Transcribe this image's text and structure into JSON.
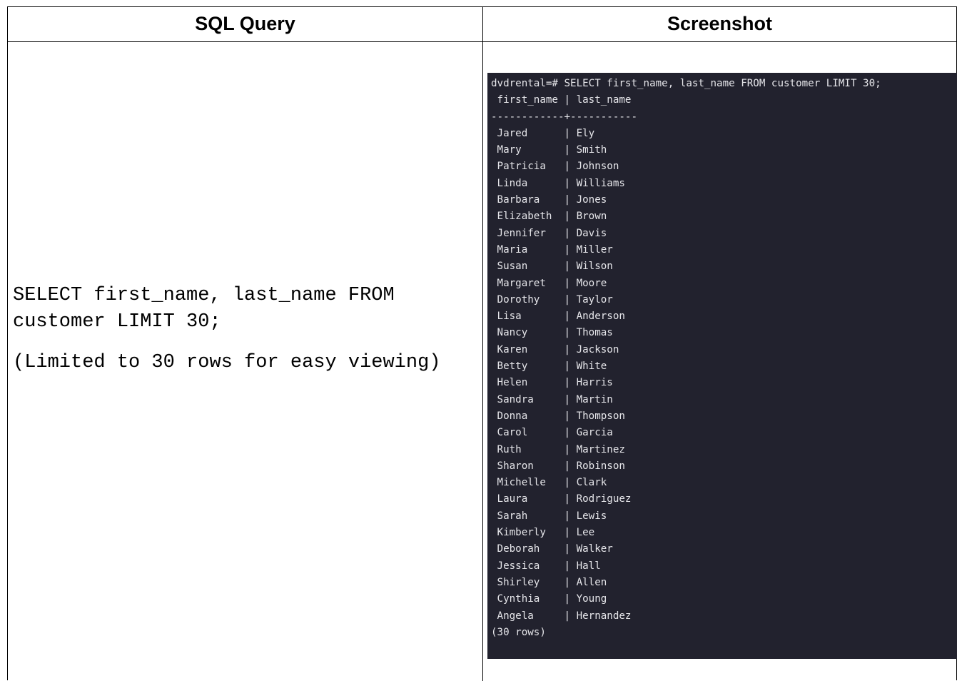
{
  "headers": {
    "left": "SQL Query",
    "right": "Screenshot"
  },
  "query": {
    "text": "SELECT first_name, last_name FROM customer LIMIT 30;",
    "note": "(Limited to 30 rows for easy viewing)"
  },
  "terminal": {
    "prompt_line": "dvdrental=# SELECT first_name, last_name FROM customer LIMIT 30;",
    "header_line": " first_name | last_name",
    "separator_line": "------------+-----------",
    "rows": [
      " Jared      | Ely",
      " Mary       | Smith",
      " Patricia   | Johnson",
      " Linda      | Williams",
      " Barbara    | Jones",
      " Elizabeth  | Brown",
      " Jennifer   | Davis",
      " Maria      | Miller",
      " Susan      | Wilson",
      " Margaret   | Moore",
      " Dorothy    | Taylor",
      " Lisa       | Anderson",
      " Nancy      | Thomas",
      " Karen      | Jackson",
      " Betty      | White",
      " Helen      | Harris",
      " Sandra     | Martin",
      " Donna      | Thompson",
      " Carol      | Garcia",
      " Ruth       | Martinez",
      " Sharon     | Robinson",
      " Michelle   | Clark",
      " Laura      | Rodriguez",
      " Sarah      | Lewis",
      " Kimberly   | Lee",
      " Deborah    | Walker",
      " Jessica    | Hall",
      " Shirley    | Allen",
      " Cynthia    | Young",
      " Angela     | Hernandez"
    ],
    "footer_line": "(30 rows)"
  }
}
